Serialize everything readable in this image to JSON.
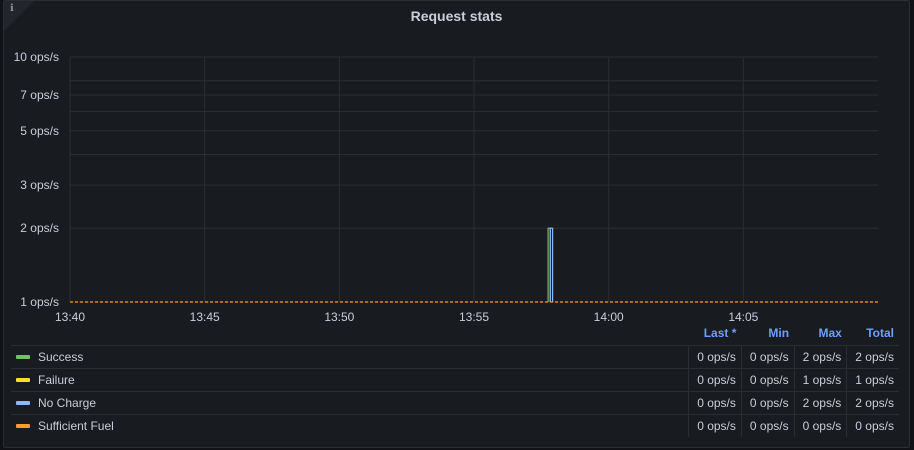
{
  "panel": {
    "title": "Request stats",
    "info_icon": "info-icon"
  },
  "chart_data": {
    "type": "line",
    "title": "Request stats",
    "y_scale": "log10",
    "ylim": [
      1,
      10
    ],
    "y_ticks": [
      {
        "value": 10,
        "label": "10 ops/s"
      },
      {
        "value": 7,
        "label": "7 ops/s"
      },
      {
        "value": 5,
        "label": "5 ops/s"
      },
      {
        "value": 3,
        "label": "3 ops/s"
      },
      {
        "value": 2,
        "label": "2 ops/s"
      },
      {
        "value": 1,
        "label": "1 ops/s"
      }
    ],
    "y_minor_grid": [
      8,
      6,
      4
    ],
    "xlim": [
      "13:40",
      "14:10"
    ],
    "x_ticks": [
      "13:40",
      "13:45",
      "13:50",
      "13:55",
      "14:00",
      "14:05"
    ],
    "grid": true,
    "legend_position": "bottom",
    "series": [
      {
        "name": "Success",
        "color": "#73bf69",
        "points": [
          [
            "13:57:45",
            1
          ],
          [
            "13:57:45",
            2
          ],
          [
            "13:57:50",
            2
          ],
          [
            "13:57:50",
            1
          ]
        ]
      },
      {
        "name": "Failure",
        "color": "#fade2a",
        "points": []
      },
      {
        "name": "No Charge",
        "color": "#8ab8ff",
        "points": [
          [
            "13:57:50",
            1
          ],
          [
            "13:57:50",
            2
          ],
          [
            "13:57:55",
            2
          ],
          [
            "13:57:55",
            1
          ]
        ]
      },
      {
        "name": "Sufficient Fuel",
        "color": "#ff9830",
        "points": [
          [
            "13:40",
            1
          ],
          [
            "14:10",
            1
          ]
        ],
        "dashed": true
      }
    ]
  },
  "legend": {
    "columns": [
      "Last *",
      "Min",
      "Max",
      "Total"
    ],
    "rows": [
      {
        "name": "Success",
        "color": "#73bf69",
        "last": "0 ops/s",
        "min": "0 ops/s",
        "max": "2 ops/s",
        "total": "2 ops/s"
      },
      {
        "name": "Failure",
        "color": "#fade2a",
        "last": "0 ops/s",
        "min": "0 ops/s",
        "max": "1 ops/s",
        "total": "1 ops/s"
      },
      {
        "name": "No Charge",
        "color": "#8ab8ff",
        "last": "0 ops/s",
        "min": "0 ops/s",
        "max": "2 ops/s",
        "total": "2 ops/s"
      },
      {
        "name": "Sufficient Fuel",
        "color": "#ff9830",
        "last": "0 ops/s",
        "min": "0 ops/s",
        "max": "0 ops/s",
        "total": "0 ops/s"
      }
    ]
  }
}
